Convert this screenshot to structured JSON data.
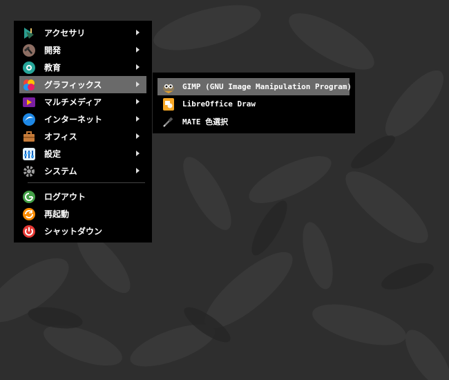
{
  "main_menu": {
    "items": [
      {
        "label": "アクセサリ",
        "icon": "accessories-icon",
        "submenu": true
      },
      {
        "label": "開発",
        "icon": "development-icon",
        "submenu": true
      },
      {
        "label": "教育",
        "icon": "education-icon",
        "submenu": true
      },
      {
        "label": "グラフィックス",
        "icon": "graphics-icon",
        "submenu": true,
        "active": true
      },
      {
        "label": "マルチメディア",
        "icon": "multimedia-icon",
        "submenu": true
      },
      {
        "label": "インターネット",
        "icon": "internet-icon",
        "submenu": true
      },
      {
        "label": "オフィス",
        "icon": "office-icon",
        "submenu": true
      },
      {
        "label": "設定",
        "icon": "settings-icon",
        "submenu": true
      },
      {
        "label": "システム",
        "icon": "system-icon",
        "submenu": true
      }
    ],
    "actions": [
      {
        "label": "ログアウト",
        "icon": "logout-icon"
      },
      {
        "label": "再起動",
        "icon": "restart-icon"
      },
      {
        "label": "シャットダウン",
        "icon": "shutdown-icon"
      }
    ]
  },
  "graphics_submenu": {
    "items": [
      {
        "label": "GIMP (GNU Image Manipulation Program)",
        "icon": "gimp-icon",
        "active": true
      },
      {
        "label": "LibreOffice Draw",
        "icon": "libreoffice-draw-icon"
      },
      {
        "label": "MATE 色選択",
        "icon": "color-picker-icon"
      }
    ]
  },
  "colors": {
    "menu_bg": "#000000",
    "highlight": "#6a6a6a",
    "text": "#ffffff",
    "wallpaper": "#2f2f2f"
  }
}
